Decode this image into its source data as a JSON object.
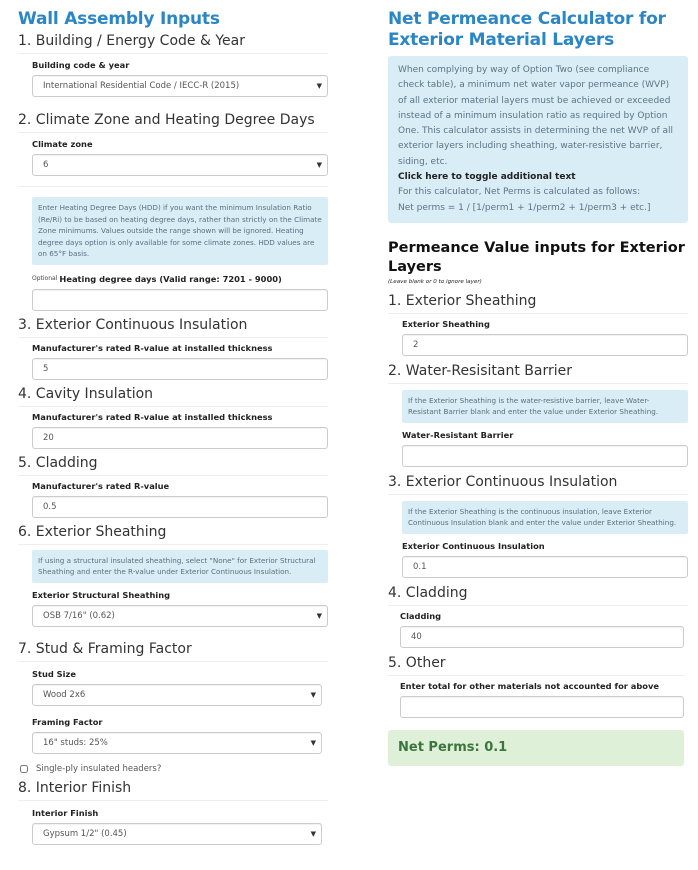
{
  "left": {
    "title": "Wall Assembly Inputs",
    "sections": {
      "s1": {
        "heading": "1. Building / Energy Code & Year",
        "label": "Building code & year",
        "value": "International Residential Code / IECC-R (2015)"
      },
      "s2": {
        "heading": "2. Climate Zone and Heating Degree Days",
        "label": "Climate zone",
        "value": "6",
        "info": "Enter Heating Degree Days (HDD) if you want the minimum Insulation Ratio (Re/Ri) to be based on heating degree days, rather than strictly on the Climate Zone minimums. Values outside the range shown will be ignored. Heating degree days option is only available for some climate zones. HDD values are on 65°F basis.",
        "hdd_optional": "Optional",
        "hdd_label": "Heating degree days (Valid range: 7201 - 9000)",
        "hdd_value": ""
      },
      "s3": {
        "heading": "3. Exterior Continuous Insulation",
        "label": "Manufacturer's rated R-value at installed thickness",
        "value": "5"
      },
      "s4": {
        "heading": "4. Cavity Insulation",
        "label": "Manufacturer's rated R-value at installed thickness",
        "value": "20"
      },
      "s5": {
        "heading": "5. Cladding",
        "label": "Manufacturer's rated R-value",
        "value": "0.5"
      },
      "s6": {
        "heading": "6. Exterior Sheathing",
        "info": "If using a structural insulated sheathing, select \"None\" for Exterior Structural Sheathing and enter the R-value under Exterior Continuous Insulation.",
        "label": "Exterior Structural Sheathing",
        "value": "OSB 7/16\" (0.62)"
      },
      "s7": {
        "heading": "7. Stud & Framing Factor",
        "stud_label": "Stud Size",
        "stud_value": "Wood 2x6",
        "framing_label": "Framing Factor",
        "framing_value": "16\" studs: 25%",
        "checkbox_label": "Single-ply insulated headers?",
        "checkbox_checked": false
      },
      "s8": {
        "heading": "8. Interior Finish",
        "label": "Interior Finish",
        "value": "Gypsum 1/2\" (0.45)"
      }
    }
  },
  "right": {
    "title": "Net Permeance Calculator for Exterior Material Layers",
    "intro": "When complying by way of Option Two (see compliance check table), a minimum net water vapor permeance (WVP) of all exterior material layers must be achieved or exceeded instead of a minimum insulation ratio as required by Option One. This calculator assists in determining the net WVP of all exterior layers including sheathing, water-resistive barrier, siding, etc.",
    "toggle_text": "Click here to toggle additional text",
    "formula_line1": "For this calculator, Net Perms is calculated as follows:",
    "formula_line2": "Net perms = 1 / [1/perm1 + 1/perm2 + 1/perm3 + etc.]",
    "inputs_heading": "Permeance Value inputs for Exterior Layers",
    "inputs_note": "(Leave blank or 0 to ignore layer)",
    "layers": {
      "l1": {
        "heading": "1. Exterior Sheathing",
        "label": "Exterior Sheathing",
        "value": "2"
      },
      "l2": {
        "heading": "2. Water-Resisitant Barrier",
        "info": "If the Exterior Sheathing is the water-resistive barrier, leave Water-Resistant Barrier blank and enter the value under Exterior Sheathing.",
        "label": "Water-Resistant Barrier",
        "value": ""
      },
      "l3": {
        "heading": "3. Exterior Continuous Insulation",
        "info": "If the Exterior Sheathing is the continuous insulation, leave Exterior Continuous Insulation blank and enter the value under Exterior Sheathing.",
        "label": "Exterior Continuous Insulation",
        "value": "0.1"
      },
      "l4": {
        "heading": "4. Cladding",
        "label": "Cladding",
        "value": "40"
      },
      "l5": {
        "heading": "5. Other",
        "label": "Enter total for other materials not accounted for above",
        "value": ""
      }
    },
    "result": "Net Perms: 0.1"
  },
  "colors": {
    "title_blue": "#2a86c5",
    "info_bg": "#d9edf7",
    "success_bg": "#dff0d8",
    "success_text": "#3c763d"
  }
}
